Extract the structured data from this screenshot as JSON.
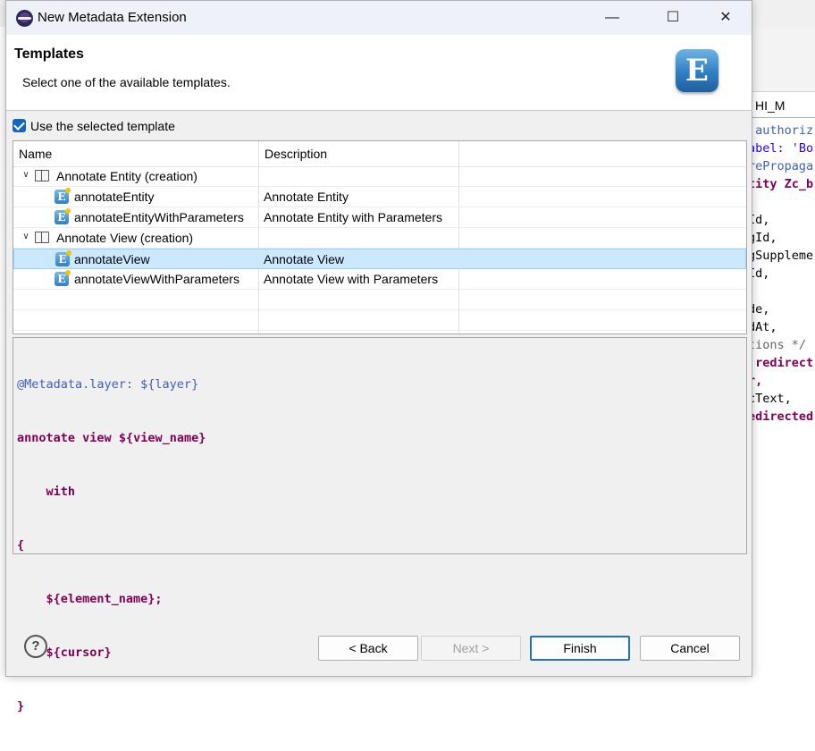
{
  "background_editor": {
    "tab_label": "HI_M",
    "code_lines": [
      {
        "text": ".authoriz",
        "color": "#3f5fbf"
      },
      {
        "text": "abel: 'Bo",
        "color": "#2a00ff"
      },
      {
        "text": "rePropaga",
        "color": "#3f5fbf"
      },
      {
        "text": "tity Zc_b",
        "color": "#7f0055",
        "bold": true
      },
      {
        "text": "",
        "color": "#000000"
      },
      {
        "text": "Id,",
        "color": "#000000"
      },
      {
        "text": "gId,",
        "color": "#000000"
      },
      {
        "text": "gSuppleme",
        "color": "#000000"
      },
      {
        "text": "Id,",
        "color": "#000000"
      },
      {
        "text": "",
        "color": "#000000"
      },
      {
        "text": "de,",
        "color": "#000000"
      },
      {
        "text": "dAt,",
        "color": "#000000"
      },
      {
        "text": "tions */",
        "color": "#646464"
      },
      {
        "text": " redirect",
        "color": "#7f0055",
        "bold": true
      },
      {
        "text": "r,",
        "color": "#7f0055",
        "bold": true
      },
      {
        "text": "cText,",
        "color": "#000000"
      },
      {
        "text": "edirected",
        "color": "#7f0055",
        "bold": true
      }
    ]
  },
  "dialog": {
    "title": "New Metadata Extension",
    "window_controls": {
      "minimize": "—",
      "maximize": "☐",
      "close": "✕"
    },
    "header": {
      "title": "Templates",
      "description": "Select one of the available templates.",
      "logo_letter": "E"
    },
    "use_template": {
      "label": "Use the selected template",
      "checked": true
    },
    "table": {
      "columns": [
        "Name",
        "Description"
      ],
      "groups": [
        {
          "label": "Annotate Entity (creation)",
          "items": [
            {
              "name": "annotateEntity",
              "description": "Annotate Entity"
            },
            {
              "name": "annotateEntityWithParameters",
              "description": "Annotate Entity with Parameters"
            }
          ]
        },
        {
          "label": "Annotate View (creation)",
          "items": [
            {
              "name": "annotateView",
              "description": "Annotate View",
              "selected": true
            },
            {
              "name": "annotateViewWithParameters",
              "description": "Annotate View with Parameters"
            }
          ]
        }
      ],
      "template_icon_letter": "E"
    },
    "preview": {
      "line1_annotation": "@Metadata.layer: ${layer}",
      "line2_kw": "annotate view",
      "line2_var": "${view_name}",
      "line3": "with",
      "line4": "{",
      "line5": "${element_name};",
      "line6": "${cursor}",
      "line7": "}"
    },
    "buttons": {
      "help": "?",
      "back": "< Back",
      "next": "Next >",
      "finish": "Finish",
      "cancel": "Cancel"
    }
  }
}
